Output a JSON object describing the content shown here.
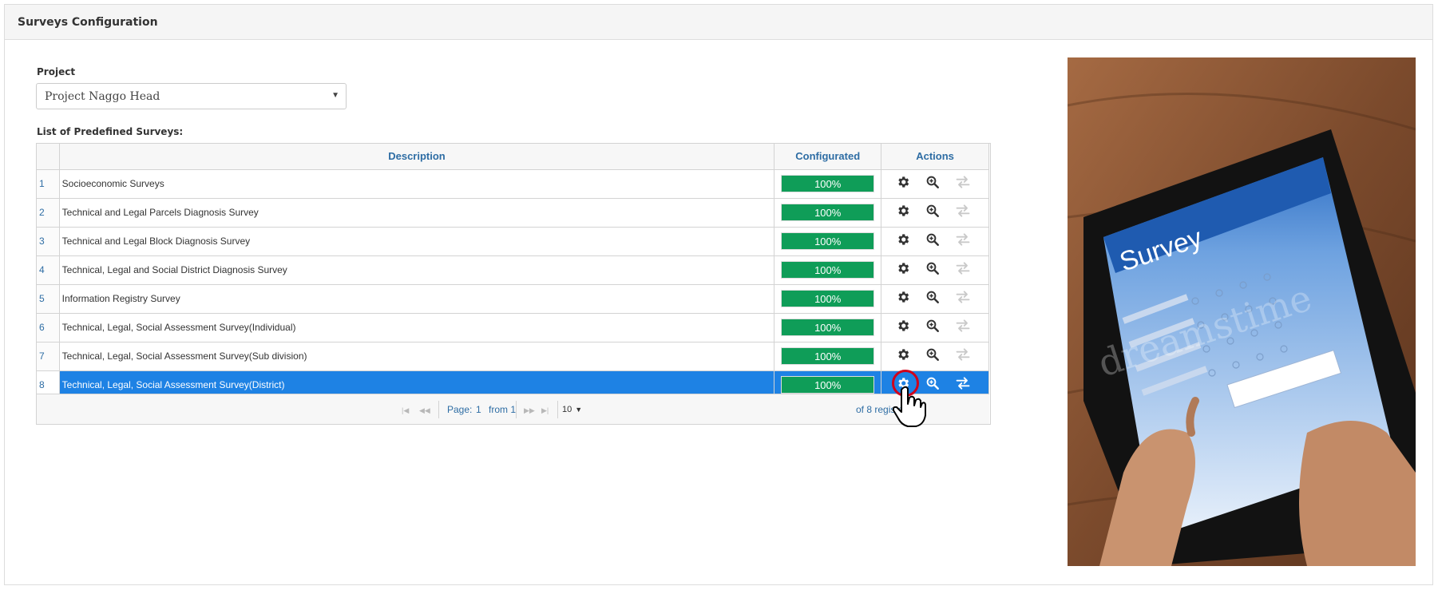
{
  "panel": {
    "title": "Surveys Configuration"
  },
  "project": {
    "label": "Project",
    "selected": "Project Naggo Head"
  },
  "list": {
    "label": "List of Predefined Surveys:",
    "columns": {
      "description": "Description",
      "configured": "Configurated",
      "actions": "Actions"
    },
    "rows": [
      {
        "num": "1",
        "description": "Socioeconomic Surveys",
        "configured": "100%",
        "selected": false
      },
      {
        "num": "2",
        "description": "Technical and Legal Parcels Diagnosis Survey",
        "configured": "100%",
        "selected": false
      },
      {
        "num": "3",
        "description": "Technical and Legal Block Diagnosis Survey",
        "configured": "100%",
        "selected": false
      },
      {
        "num": "4",
        "description": "Technical, Legal and Social District Diagnosis Survey",
        "configured": "100%",
        "selected": false
      },
      {
        "num": "5",
        "description": "Information Registry Survey",
        "configured": "100%",
        "selected": false
      },
      {
        "num": "6",
        "description": "Technical, Legal, Social Assessment Survey(Individual)",
        "configured": "100%",
        "selected": false
      },
      {
        "num": "7",
        "description": "Technical, Legal, Social Assessment Survey(Sub division)",
        "configured": "100%",
        "selected": false
      },
      {
        "num": "8",
        "description": "Technical, Legal, Social Assessment Survey(District)",
        "configured": "100%",
        "selected": true
      }
    ]
  },
  "pager": {
    "page_label": "Page:",
    "page": "1",
    "from_label": "from 1",
    "page_size": "10",
    "records_text": "of 8 registers"
  },
  "image": {
    "survey_title": "Survey",
    "watermark": "dreamstime"
  },
  "colors": {
    "accent": "#2e6da4",
    "progress": "#0f9d58",
    "selected_row": "#1e82e4",
    "cursor_ring": "#d0021b"
  },
  "icons": {
    "configure": "gear-icon",
    "view": "zoom-in-icon",
    "transfer": "swap-arrows-icon"
  }
}
